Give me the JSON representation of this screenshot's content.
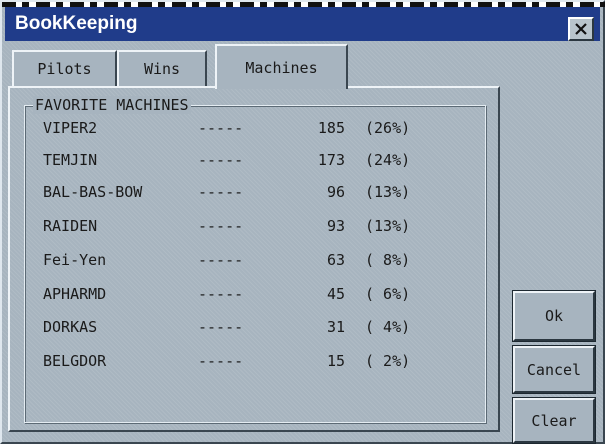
{
  "window": {
    "title": "BookKeeping",
    "close_icon": "close-x-icon"
  },
  "tabs": [
    {
      "label": "Pilots",
      "selected": false
    },
    {
      "label": "Wins",
      "selected": false
    },
    {
      "label": "Machines",
      "selected": true
    }
  ],
  "group": {
    "title": "FAVORITE MACHINES",
    "rows": [
      {
        "name": "VIPER2",
        "dash": "-----",
        "count": "185",
        "pct": "(26%)"
      },
      {
        "name": "TEMJIN",
        "dash": "-----",
        "count": "173",
        "pct": "(24%)"
      },
      {
        "name": "BAL-BAS-BOW",
        "dash": "-----",
        "count": "96",
        "pct": "(13%)"
      },
      {
        "name": "RAIDEN",
        "dash": "-----",
        "count": "93",
        "pct": "(13%)"
      },
      {
        "name": "Fei-Yen",
        "dash": "-----",
        "count": "63",
        "pct": "( 8%)"
      },
      {
        "name": "APHARMD",
        "dash": "-----",
        "count": "45",
        "pct": "( 6%)"
      },
      {
        "name": "DORKAS",
        "dash": "-----",
        "count": "31",
        "pct": "( 4%)"
      },
      {
        "name": "BELGDOR",
        "dash": "-----",
        "count": "15",
        "pct": "( 2%)"
      }
    ]
  },
  "buttons": {
    "ok": "Ok",
    "cancel": "Cancel",
    "clear": "Clear"
  }
}
